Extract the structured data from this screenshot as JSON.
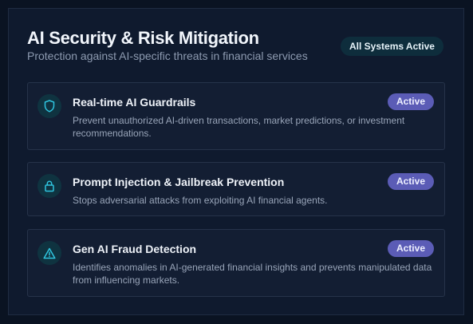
{
  "header": {
    "title": "AI Security & Risk Mitigation",
    "subtitle": "Protection against AI-specific threats in financial services",
    "badge": "All Systems Active"
  },
  "cards": [
    {
      "icon": "shield-icon",
      "title": "Real-time AI Guardrails",
      "description": "Prevent unauthorized AI-driven transactions, market predictions, or investment recommendations.",
      "status": "Active"
    },
    {
      "icon": "lock-icon",
      "title": "Prompt Injection & Jailbreak Prevention",
      "description": "Stops adversarial attacks from exploiting AI financial agents.",
      "status": "Active"
    },
    {
      "icon": "warning-icon",
      "title": "Gen AI Fraud Detection",
      "description": "Identifies anomalies in AI-generated financial insights and prevents manipulated data from influencing markets.",
      "status": "Active"
    }
  ],
  "colors": {
    "background": "#0f1a2e",
    "accent": "#2fc4de",
    "status_badge": "#5b5cb6"
  }
}
